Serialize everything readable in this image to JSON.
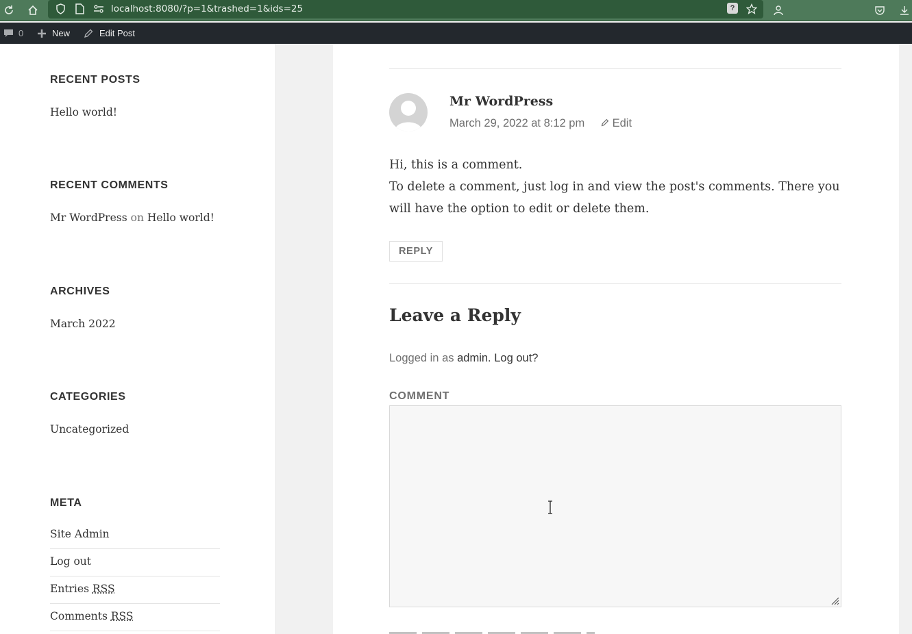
{
  "browser": {
    "url": "localhost:8080/?p=1&trashed=1&ids=25",
    "help_badge": "?"
  },
  "admin_bar": {
    "comments_count": "0",
    "new_label": "New",
    "edit_post_label": "Edit Post"
  },
  "sidebar": {
    "recent_posts": {
      "title": "RECENT POSTS",
      "items": [
        "Hello world!"
      ]
    },
    "recent_comments": {
      "title": "RECENT COMMENTS",
      "author": "Mr WordPress",
      "on_text": "on",
      "post": "Hello world!"
    },
    "archives": {
      "title": "ARCHIVES",
      "items": [
        "March 2022"
      ]
    },
    "categories": {
      "title": "CATEGORIES",
      "items": [
        "Uncategorized"
      ]
    },
    "meta": {
      "title": "META",
      "site_admin": "Site Admin",
      "log_out": "Log out",
      "entries": "Entries",
      "comments": "Comments",
      "rss": "RSS"
    }
  },
  "comment": {
    "author": "Mr WordPress",
    "date": "March 29, 2022 at 8:12 pm",
    "edit_label": "Edit",
    "body_line1": "Hi, this is a comment.",
    "body_line2": "To delete a comment, just log in and view the post's comments. There you will have the option to edit or delete them.",
    "reply_label": "REPLY"
  },
  "reply_form": {
    "title": "Leave a Reply",
    "logged_in_prefix": "Logged in as",
    "user": "admin",
    "log_out": "Log out?",
    "comment_label": "COMMENT",
    "comment_value": ""
  }
}
